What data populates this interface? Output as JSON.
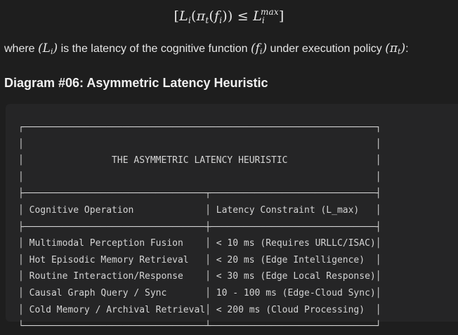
{
  "formula": {
    "open": "[",
    "L": "L",
    "i": "i",
    "pi": "π",
    "t": "t",
    "f": "f",
    "leq": "≤",
    "max": "max",
    "close": "]"
  },
  "description": {
    "where": "where",
    "is_latency": "is the latency of the cognitive function",
    "under_policy": "under execution policy",
    "colon": ":"
  },
  "heading": "Diagram #06: Asymmetric Latency Heuristic",
  "diagram": {
    "title": "THE ASYMMETRIC LATENCY HEURISTIC",
    "col1_header": "Cognitive Operation",
    "col2_header": "Latency Constraint (L_max)",
    "rows": [
      {
        "operation": "Multimodal Perception Fusion",
        "constraint": "< 10 ms (Requires URLLC/ISAC)"
      },
      {
        "operation": "Hot Episodic Memory Retrieval",
        "constraint": "< 20 ms (Edge Intelligence)"
      },
      {
        "operation": "Routine Interaction/Response",
        "constraint": "< 30 ms (Edge Local Response)"
      },
      {
        "operation": "Causal Graph Query / Sync",
        "constraint": "10 - 100 ms (Edge-Cloud Sync)"
      },
      {
        "operation": "Cold Memory / Archival Retrieval",
        "constraint": "< 200 ms (Cloud Processing)"
      }
    ]
  }
}
